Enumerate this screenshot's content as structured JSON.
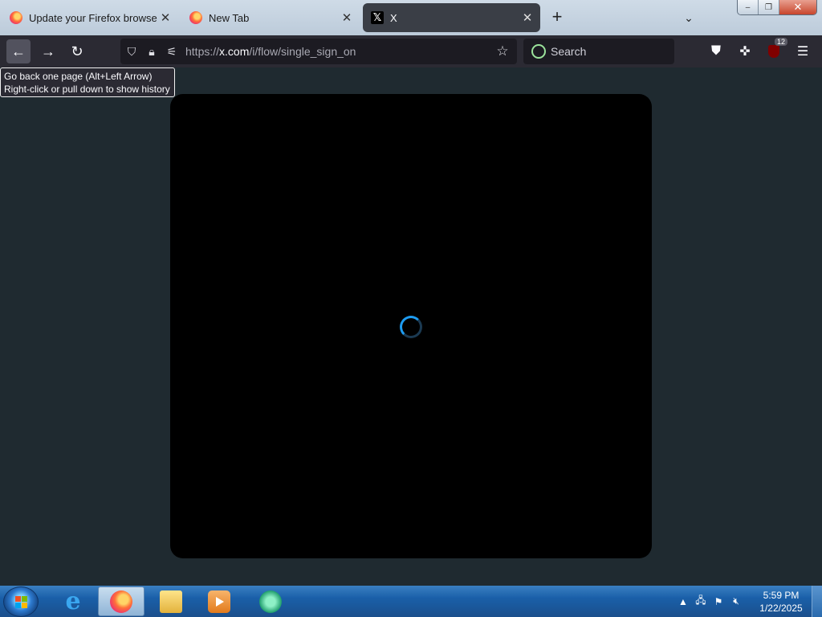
{
  "tabs": [
    {
      "label": "Update your Firefox browser",
      "icon": "firefox-icon",
      "active": false
    },
    {
      "label": "New Tab",
      "icon": "firefox-icon",
      "active": false
    },
    {
      "label": "X",
      "icon": "x-logo-icon",
      "active": true
    }
  ],
  "window_controls": {
    "minimize": "–",
    "restore": "❐",
    "close": "✕"
  },
  "nav": {
    "back_icon": "←",
    "forward_icon": "→",
    "reload_icon": "↻",
    "url_prefix": "https://",
    "url_host": "x.com",
    "url_path": "/i/flow/single_sign_on",
    "search_label": "Search",
    "extension_badge": "12"
  },
  "tooltip": {
    "line1": "Go back one page (Alt+Left Arrow)",
    "line2": "Right-click or pull down to show history"
  },
  "taskbar": {
    "time": "5:59 PM",
    "date": "1/22/2025",
    "apps": [
      "internet-explorer",
      "firefox",
      "file-explorer",
      "media-player",
      "green-app"
    ]
  },
  "colors": {
    "accent": "#1d9bf0",
    "page_bg": "#1f2a30",
    "modal_bg": "#000000",
    "toolbar_bg": "#2b2a33"
  }
}
